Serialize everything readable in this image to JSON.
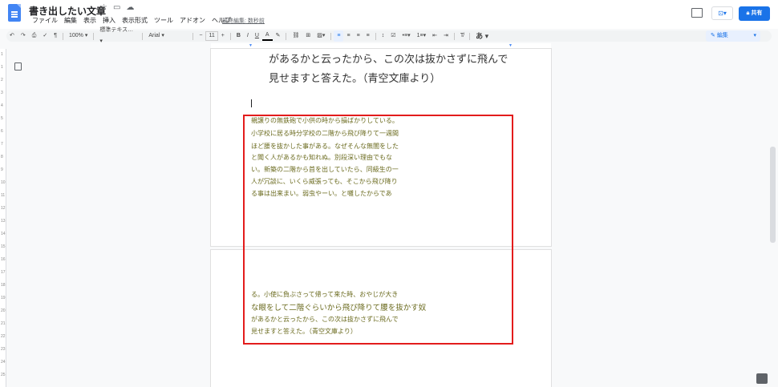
{
  "app": {
    "title": "書き出したい文章",
    "menu": [
      "ファイル",
      "編集",
      "表示",
      "挿入",
      "表示形式",
      "ツール",
      "アドオン",
      "ヘルプ"
    ],
    "last_edit": "最終編集: 数秒前",
    "share_label": "共有"
  },
  "toolbar": {
    "zoom": "100%",
    "style": "標準テキス…",
    "font": "Arial",
    "font_size": "11",
    "bold": "B",
    "italic": "I",
    "underline": "U",
    "text_color": "A",
    "input_tool": "あ",
    "mode_label": "編集"
  },
  "ruler": {
    "v_ticks": [
      "1",
      "1",
      "2",
      "3",
      "4",
      "5",
      "6",
      "7",
      "8",
      "9",
      "10",
      "11",
      "12",
      "13",
      "14",
      "15",
      "16",
      "17",
      "18",
      "19",
      "20",
      "21",
      "22",
      "23",
      "24",
      "25"
    ]
  },
  "document": {
    "page1_big": [
      "があるかと云ったから、この次は抜かさずに飛んで",
      "見せますと答えた。（青空文庫より）"
    ],
    "highlighted_page1": [
      "親譲りの無鉄砲で小供の時から損ばかりしている。",
      "小学校に居る時分学校の二階から飛び降りて一週間",
      "ほど腰を抜かした事がある。なぜそんな無闇をした",
      "と聞く人があるかも知れぬ。別段深い理由でもな",
      "い。新築の二階から首を出していたら、同級生の一",
      "人が冗談に、いくら威張っても、そこから飛び降り",
      "る事は出来まい。弱虫やーい。と囃したからであ"
    ],
    "highlighted_page2": [
      "る。小使に負ぶさって帰って来た時、おやじが大き",
      "な眼をして二階ぐらいから飛び降りて腰を抜かす奴",
      "があるかと云ったから、この次は抜かさずに飛んで",
      "見せますと答えた。（青空文庫より）"
    ]
  },
  "colors": {
    "accent": "#1a73e8",
    "highlight_border": "#e31c1c",
    "greyed_text": "#6b6b1f"
  }
}
